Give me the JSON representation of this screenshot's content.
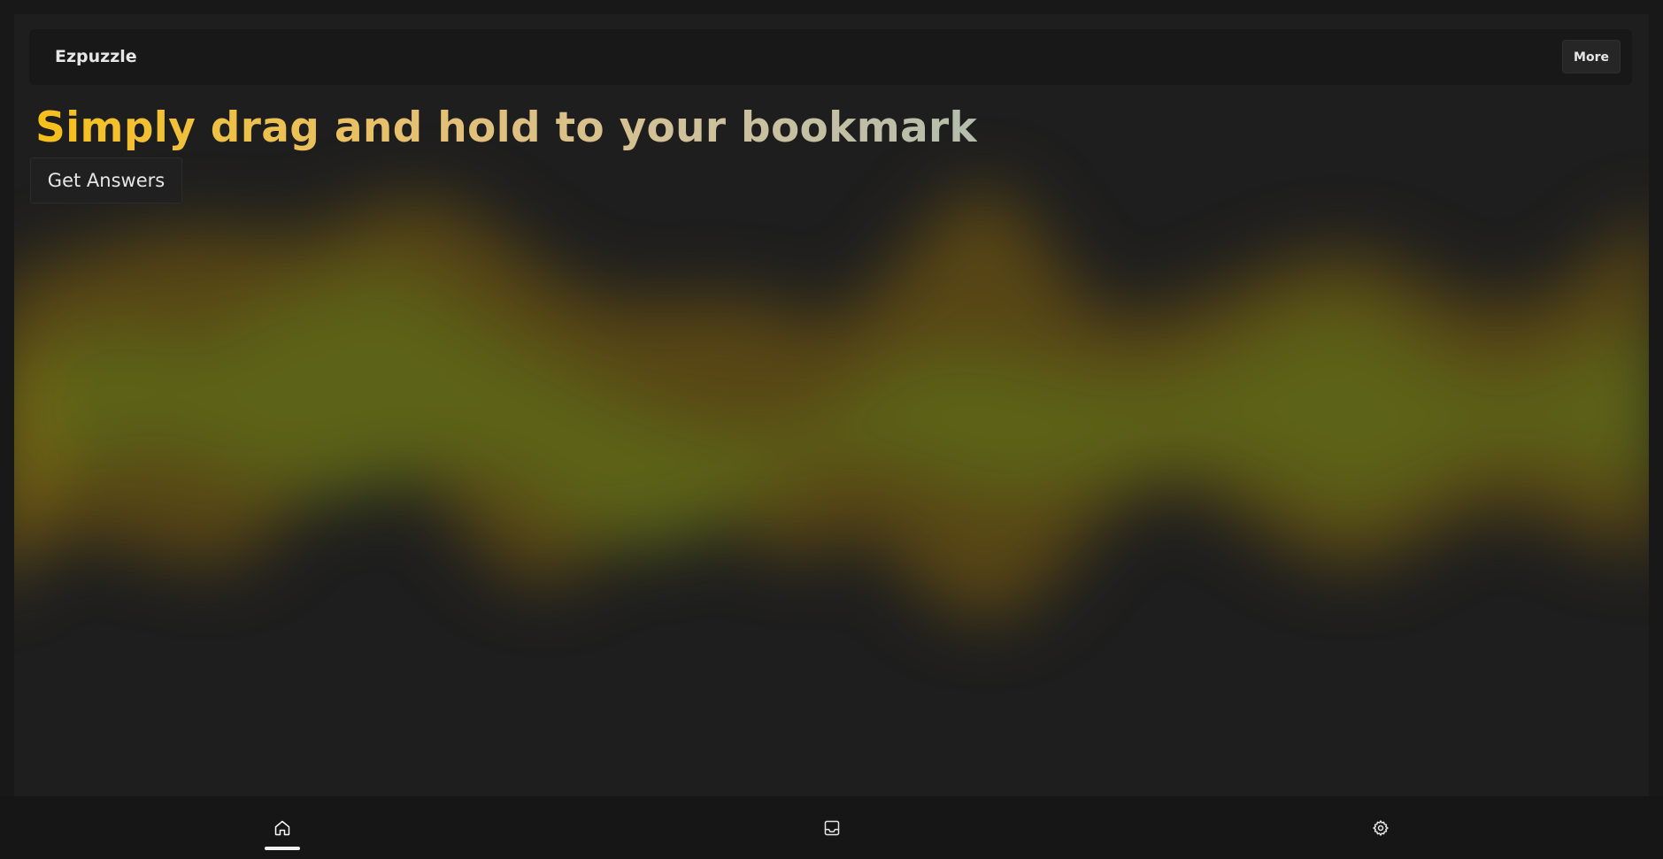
{
  "app": {
    "title": "Ezpuzzle",
    "more_label": "More"
  },
  "hero": {
    "headline": "Simply drag and hold to your bookmark",
    "cta_label": "Get Answers"
  },
  "nav": {
    "items": [
      {
        "name": "home",
        "icon": "home-icon",
        "active": true
      },
      {
        "name": "inbox",
        "icon": "inbox-icon",
        "active": false
      },
      {
        "name": "settings",
        "icon": "gear-icon",
        "active": false
      }
    ]
  },
  "colors": {
    "background": "#1e1e1e",
    "accent_yellow": "#f6c019",
    "wave_green": "#5a5e1a",
    "wave_amber": "#6b5216"
  }
}
